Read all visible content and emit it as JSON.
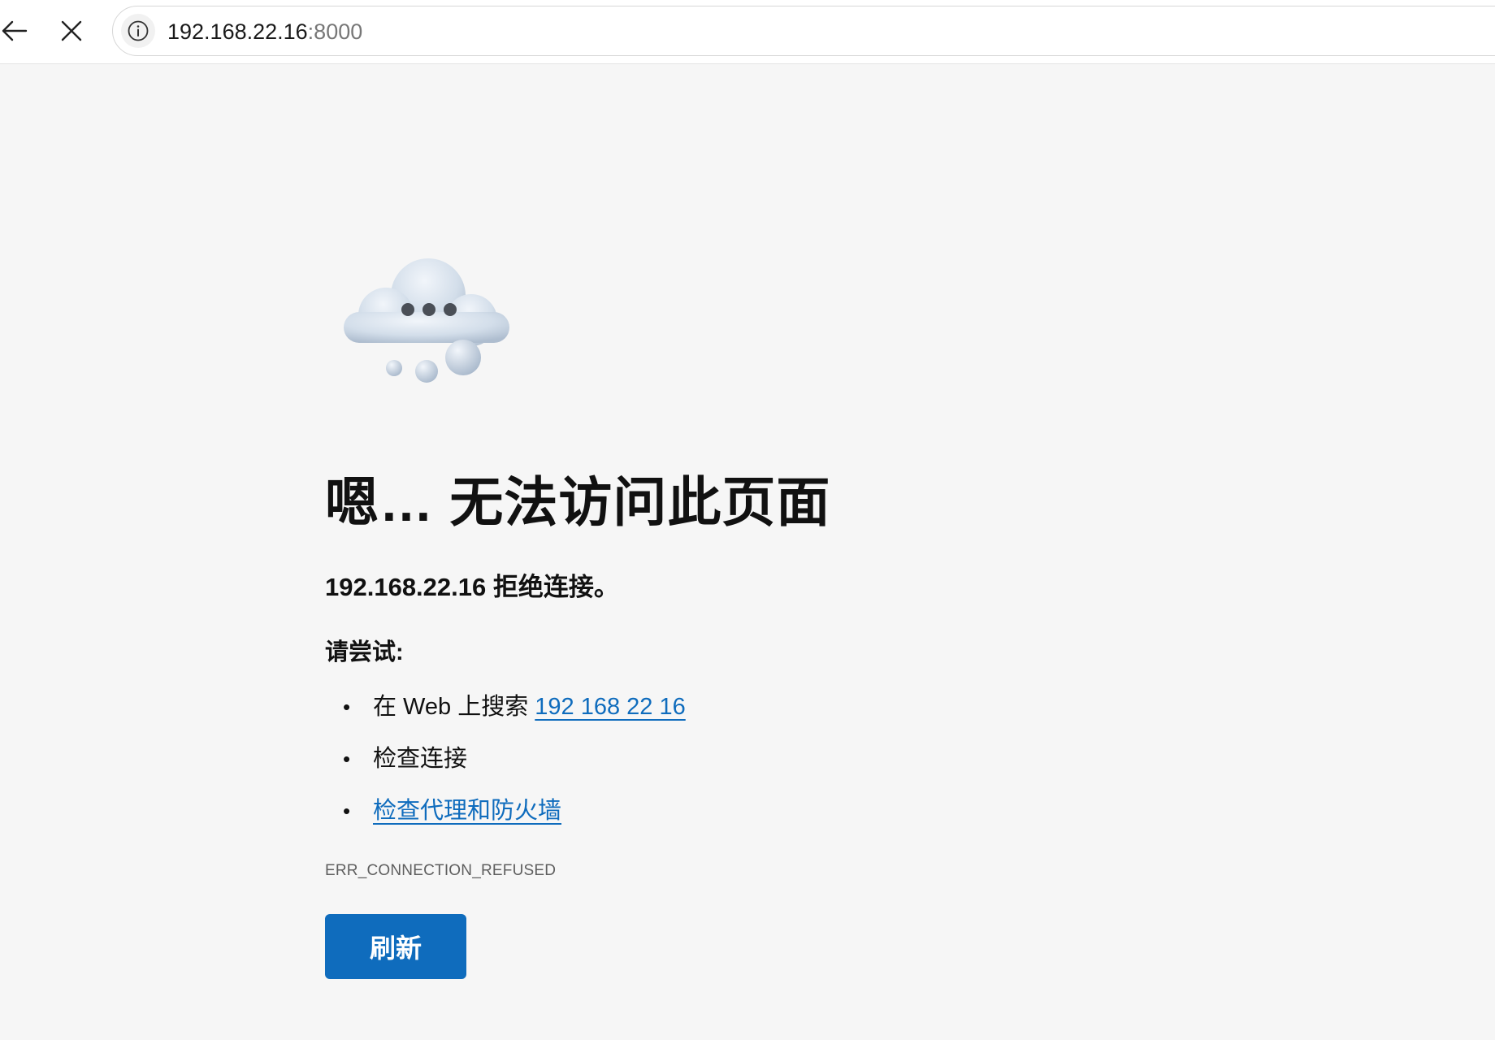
{
  "toolbar": {
    "back_icon": "arrow-left-icon",
    "stop_icon": "close-icon",
    "info_icon": "info-circle-icon",
    "url_host": "192.168.22.16",
    "url_port": ":8000"
  },
  "error_page": {
    "illustration": "cloud-with-dots",
    "title": "嗯… 无法访问此页面",
    "summary": "192.168.22.16 拒绝连接。",
    "try_heading": "请尝试:",
    "suggestions": [
      {
        "prefix": "在 Web 上搜索 ",
        "link": "192 168 22 16"
      },
      {
        "text": "检查连接"
      },
      {
        "link": "检查代理和防火墙"
      }
    ],
    "error_code": "ERR_CONNECTION_REFUSED",
    "refresh_label": "刷新"
  },
  "colors": {
    "background": "#f6f6f6",
    "accent": "#0f6cbd",
    "link": "#0f6cbd"
  }
}
